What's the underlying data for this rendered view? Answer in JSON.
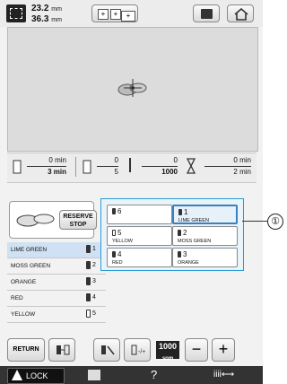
{
  "header": {
    "width": "23.2",
    "height": "36.3",
    "unit": "mm"
  },
  "times": {
    "left_top": "0",
    "left_unit": "min",
    "left_bottom": "3",
    "mid1_top": "0",
    "mid1_bottom": "5",
    "mid2_top": "0",
    "mid2_bottom": "1000",
    "right_top": "0",
    "right_unit": "min",
    "right_bottom": "2"
  },
  "reserve_stop": "RESERVE STOP",
  "thread_list": [
    {
      "name": "LIME GREEN",
      "number": "1",
      "spool": "dark"
    },
    {
      "name": "MOSS GREEN",
      "number": "2",
      "spool": "dark"
    },
    {
      "name": "ORANGE",
      "number": "3",
      "spool": "dark"
    },
    {
      "name": "RED",
      "number": "4",
      "spool": "dark"
    },
    {
      "name": "YELLOW",
      "number": "5",
      "spool": "white"
    }
  ],
  "needle_grid": [
    {
      "number": "6",
      "name": "",
      "spool": "dark"
    },
    {
      "number": "1",
      "name": "LIME GREEN",
      "spool": "dark"
    },
    {
      "number": "5",
      "name": "YELLOW",
      "spool": "white"
    },
    {
      "number": "2",
      "name": "MOSS GREEN",
      "spool": "dark"
    },
    {
      "number": "4",
      "name": "RED",
      "spool": "dark"
    },
    {
      "number": "3",
      "name": "ORANGE",
      "spool": "dark"
    }
  ],
  "callout": "①",
  "bottom": {
    "return_label": "RETURN",
    "speed_value": "1000",
    "speed_unit": "spm"
  },
  "footer": {
    "lock_label": "LOCK"
  },
  "colors": {
    "accent": "#2a9bd6",
    "footer": "#333333"
  }
}
